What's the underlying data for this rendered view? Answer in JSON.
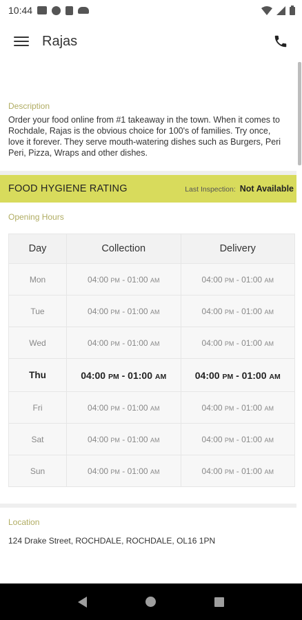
{
  "status_bar": {
    "time": "10:44",
    "left_icons": [
      "gmail-icon",
      "news-icon",
      "sd-card-icon",
      "cloud-icon"
    ],
    "right_icons": [
      "wifi-icon",
      "signal-icon",
      "battery-icon"
    ]
  },
  "app_bar": {
    "title": "Rajas",
    "menu_icon": "hamburger-menu-icon",
    "call_icon": "phone-icon"
  },
  "description": {
    "label": "Description",
    "text": "Order your food online from #1 takeaway in the town. When it comes to Rochdale, Rajas is the obvious choice for 100's of families. Try once, love it forever. They serve mouth-watering dishes such as Burgers, Peri Peri, Pizza, Wraps and other dishes."
  },
  "hygiene": {
    "title": "FOOD HYGIENE RATING",
    "inspection_label": "Last Inspection:",
    "inspection_value": "Not Available",
    "color": "#d8db5c"
  },
  "opening_hours": {
    "label": "Opening Hours",
    "headers": [
      "Day",
      "Collection",
      "Delivery"
    ],
    "rows": [
      {
        "day": "Mon",
        "c_open": "04:00",
        "c_open_ampm": "PM",
        "c_close": "01:00",
        "c_close_ampm": "AM",
        "d_open": "04:00",
        "d_open_ampm": "PM",
        "d_close": "01:00",
        "d_close_ampm": "AM"
      },
      {
        "day": "Tue",
        "c_open": "04:00",
        "c_open_ampm": "PM",
        "c_close": "01:00",
        "c_close_ampm": "AM",
        "d_open": "04:00",
        "d_open_ampm": "PM",
        "d_close": "01:00",
        "d_close_ampm": "AM"
      },
      {
        "day": "Wed",
        "c_open": "04:00",
        "c_open_ampm": "PM",
        "c_close": "01:00",
        "c_close_ampm": "AM",
        "d_open": "04:00",
        "d_open_ampm": "PM",
        "d_close": "01:00",
        "d_close_ampm": "AM"
      },
      {
        "day": "Thu",
        "c_open": "04:00",
        "c_open_ampm": "PM",
        "c_close": "01:00",
        "c_close_ampm": "AM",
        "d_open": "04:00",
        "d_open_ampm": "PM",
        "d_close": "01:00",
        "d_close_ampm": "AM"
      },
      {
        "day": "Fri",
        "c_open": "04:00",
        "c_open_ampm": "PM",
        "c_close": "01:00",
        "c_close_ampm": "AM",
        "d_open": "04:00",
        "d_open_ampm": "PM",
        "d_close": "01:00",
        "d_close_ampm": "AM"
      },
      {
        "day": "Sat",
        "c_open": "04:00",
        "c_open_ampm": "PM",
        "c_close": "01:00",
        "c_close_ampm": "AM",
        "d_open": "04:00",
        "d_open_ampm": "PM",
        "d_close": "01:00",
        "d_close_ampm": "AM"
      },
      {
        "day": "Sun",
        "c_open": "04:00",
        "c_open_ampm": "PM",
        "c_close": "01:00",
        "c_close_ampm": "AM",
        "d_open": "04:00",
        "d_open_ampm": "PM",
        "d_close": "01:00",
        "d_close_ampm": "AM"
      }
    ],
    "today": "Thu"
  },
  "location": {
    "label": "Location",
    "address": "124 Drake Street, ROCHDALE, ROCHDALE, OL16 1PN"
  },
  "nav_bar": {
    "buttons": [
      "back-icon",
      "home-icon",
      "recents-icon"
    ]
  }
}
